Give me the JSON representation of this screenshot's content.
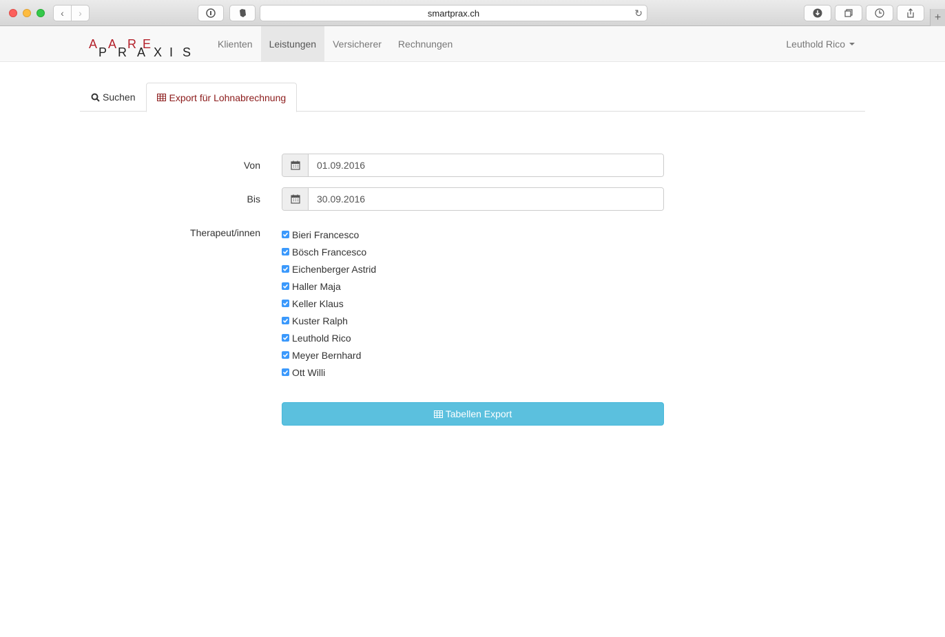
{
  "browser": {
    "url": "smartprax.ch"
  },
  "navbar": {
    "logo_letters": [
      "A",
      "P",
      "A",
      "R",
      "R",
      "A",
      "E",
      "X",
      "I",
      "S"
    ],
    "items": [
      {
        "label": "Klienten",
        "active": false
      },
      {
        "label": "Leistungen",
        "active": true
      },
      {
        "label": "Versicherer",
        "active": false
      },
      {
        "label": "Rechnungen",
        "active": false
      }
    ],
    "user": "Leuthold Rico"
  },
  "tabs": [
    {
      "label": "Suchen",
      "icon": "search-icon",
      "active": false
    },
    {
      "label": "Export für Lohnabrechnung",
      "icon": "table-icon",
      "active": true
    }
  ],
  "form": {
    "von_label": "Von",
    "von_value": "01.09.2016",
    "bis_label": "Bis",
    "bis_value": "30.09.2016",
    "therapists_label": "Therapeut/innen",
    "therapists": [
      {
        "name": "Bieri Francesco",
        "checked": true
      },
      {
        "name": "Bösch Francesco",
        "checked": true
      },
      {
        "name": "Eichenberger Astrid",
        "checked": true
      },
      {
        "name": "Haller Maja",
        "checked": true
      },
      {
        "name": "Keller Klaus",
        "checked": true
      },
      {
        "name": "Kuster Ralph",
        "checked": true
      },
      {
        "name": "Leuthold Rico",
        "checked": true
      },
      {
        "name": "Meyer Bernhard",
        "checked": true
      },
      {
        "name": "Ott Willi",
        "checked": true
      }
    ],
    "export_label": "Tabellen Export"
  },
  "colors": {
    "accent": "#8b1a1a",
    "logo_red": "#b3202a",
    "button": "#5bc0de",
    "checkbox": "#3b99fc"
  }
}
